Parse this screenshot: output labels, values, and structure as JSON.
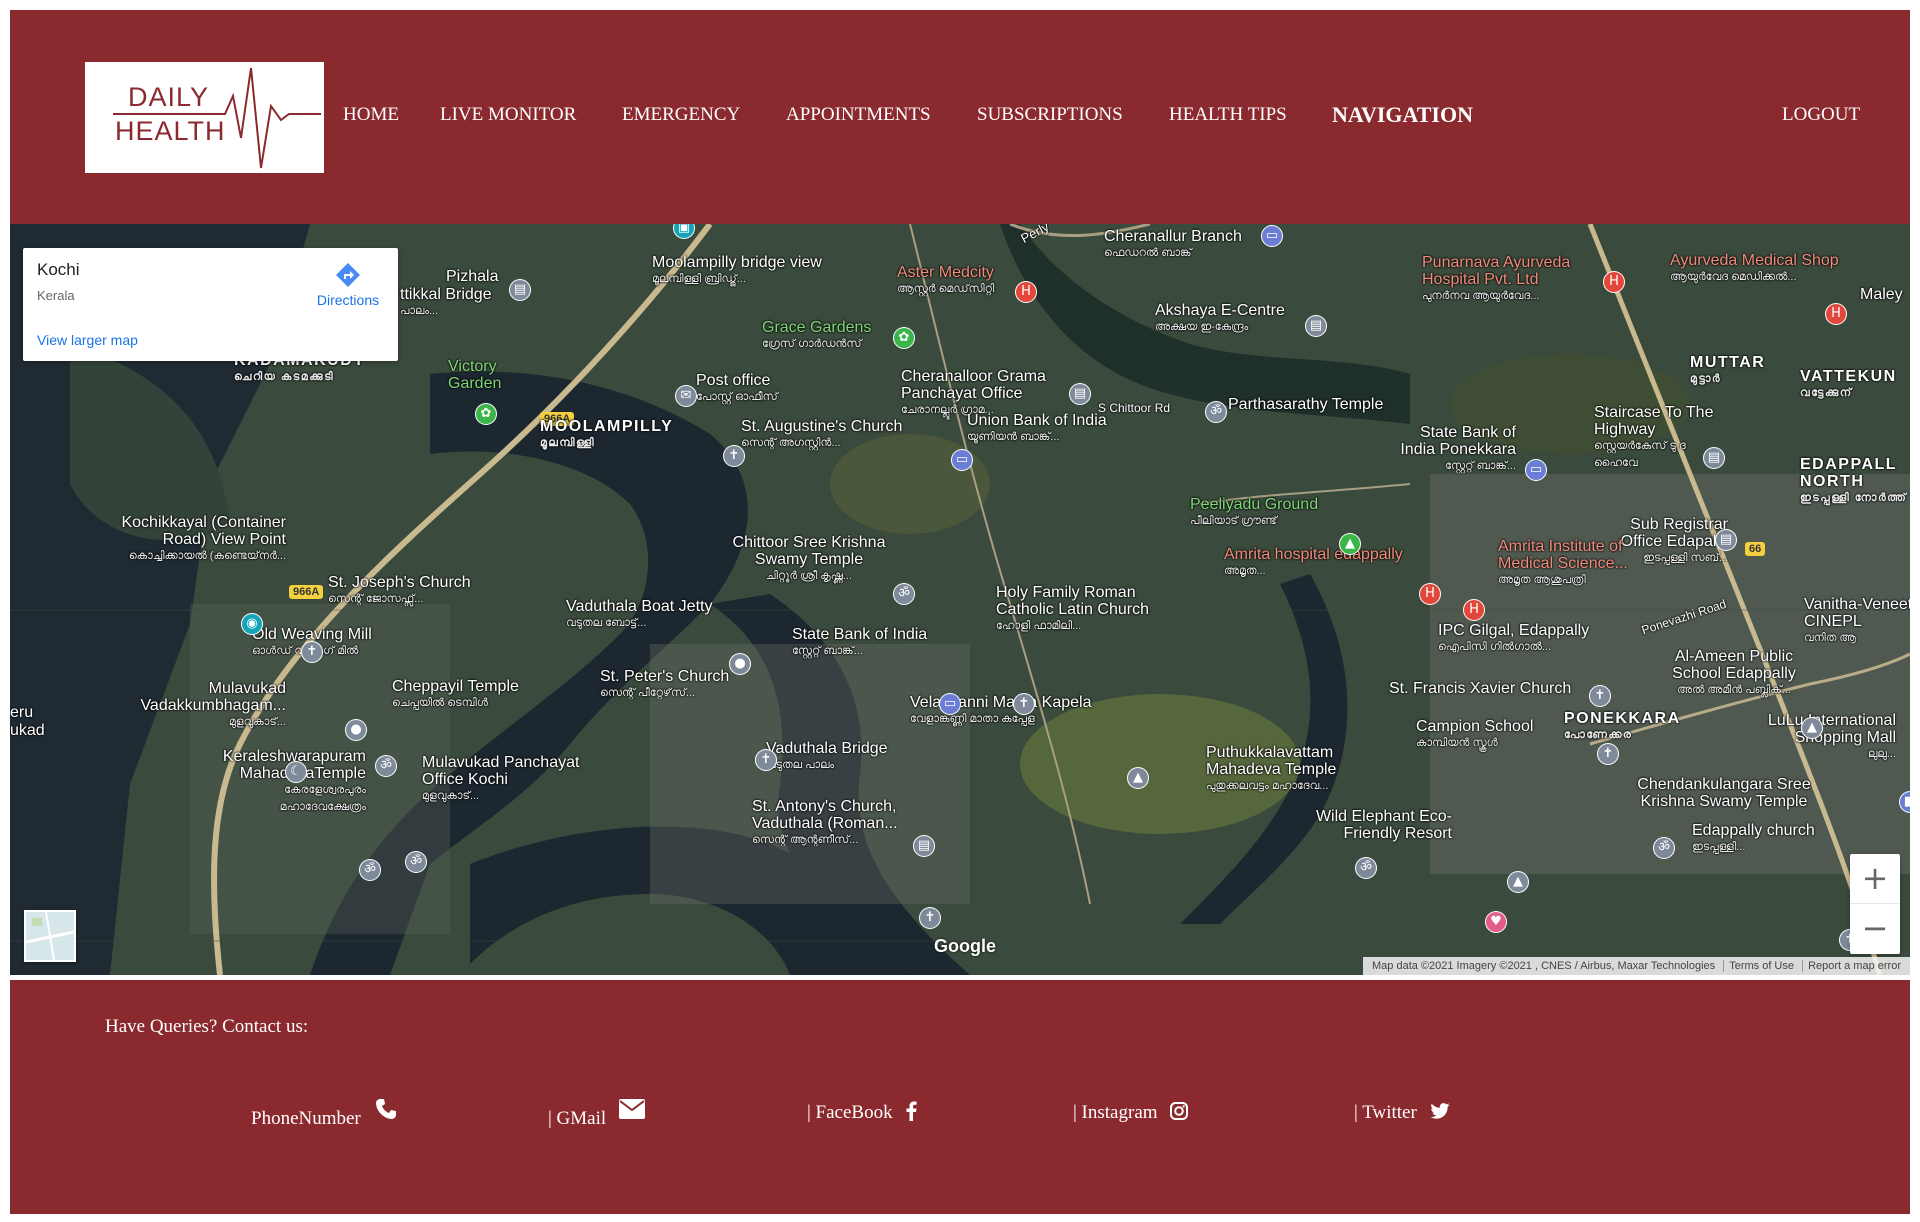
{
  "brand": {
    "line1": "DAILY",
    "line2": "HEALTH",
    "accent": "#8b2a2e"
  },
  "nav": {
    "items": [
      "HOME",
      "LIVE MONITOR",
      "EMERGENCY",
      "APPOINTMENTS",
      "SUBSCRIPTIONS",
      "HEALTH TIPS",
      "NAVIGATION"
    ],
    "active": "NAVIGATION",
    "logout": "LOGOUT"
  },
  "map": {
    "info": {
      "place": "Kochi",
      "region": "Kerala",
      "directions": "Directions",
      "larger": "View larger map"
    },
    "zoom_in": "+",
    "zoom_out": "−",
    "google": "Google",
    "attribution": [
      "Map data ©2021 Imagery ©2021 , CNES / Airbus, Maxar Technologies",
      "Terms of Use",
      "Report a map error"
    ],
    "labels": {
      "moolampilly_bridge": "Moolampilly bridge view",
      "moolampilly_bridge_ml": "മൂലമ്പിള്ളി ബ്രിഡ്ജ്...",
      "aster": "Aster Medcity",
      "aster_ml": "ആസ്റ്റർ മെഡ്‌സിറ്റി",
      "cheranallur_branch": "Cheranallur Branch",
      "cheranallur_branch_ml": "ഫെഡറൽ ബാങ്ക്",
      "punarnava": "Punarnava Ayurveda Hospital Pvt. Ltd",
      "punarnava_ml": "പുനർനവ ആയുർവേദ...",
      "ayurvedic_shop": "Ayurveda Medical Shop",
      "ayurvedic_shop_ml": "ആയുർവേദ മെഡിക്കൽ...",
      "maley": "Maley",
      "pizhala": "Pizhala",
      "kattikkal": "ttikkal Bridge",
      "kattikkal_ml": "പാലം...",
      "grace_gardens": "Grace Gardens",
      "grace_gardens_ml": "ഗ്രേസ് ഗാർഡൻസ്",
      "akshaya": "Akshaya E-Centre",
      "akshaya_ml": "അക്ഷയ ഇ-കേന്ദ്രം",
      "kadamakudy": "KADAMAKUDY",
      "kadamakudy_ml": "ചെറിയ കടമക്കുടി",
      "victory_garden": "Victory Garden",
      "post_office": "Post office",
      "post_office_ml": "പോസ്റ്റ് ഓഫീസ്",
      "cheranalloor_grama": "Cheranalloor Grama Panchayat Office",
      "cheranalloor_grama_ml": "ചേരാനല്ലൂർ ഗ്രാമ...",
      "parthasarathy": "Parthasarathy Temple",
      "muttar": "MUTTAR",
      "muttar_ml": "മുട്ടാർ",
      "vattekun": "VATTEKUN",
      "vattekun_ml": "വട്ടേക്കുന്",
      "moolampilly": "MOOLAMPILLY",
      "moolampilly_ml": "മൂലമ്പിള്ളി",
      "st_augustine": "St. Augustine's Church",
      "st_augustine_ml": "സെന്റ് അഗസ്റ്റിൻ...",
      "union_bank": "Union Bank of India",
      "union_bank_ml": "യൂണിയൻ ബാങ്ക്...",
      "s_chittoor": "S Chittoor Rd",
      "sbi_ponekkara": "State Bank of India Ponekkara",
      "sbi_ponekkara_ml": "സ്റ്റേറ്റ് ബാങ്ക്...",
      "staircase": "Staircase To The Highway",
      "staircase_ml": "സ്റ്റെയർകേസ് ടു ദ ഹൈവേ",
      "edappally_north": "EDAPPALL NORTH",
      "edappally_north_ml": "ഇടപ്പള്ളി നോർത്ത്",
      "kochikkayal": "Kochikkayal (Container Road) View Point",
      "kochikkayal_ml": "കൊച്ചിക്കായൽ (കണ്ടെയ്‌നർ...",
      "peeliyadu": "Peeliyadu Ground",
      "peeliyadu_ml": "പീലിയാട് ഗ്രൗണ്ട്",
      "sub_registrar": "Sub Registrar Office Edapally",
      "sub_registrar_ml": "ഇടപ്പള്ളി സബ്...",
      "chittoor_sree": "Chittoor Sree Krishna Swamy Temple",
      "chittoor_sree_ml": "ചിറ്റൂർ ശ്രീ കൃഷ്ണ...",
      "amrita_hosp": "Amrita hospital edappally",
      "amrita_hosp_ml": "അമൃത...",
      "amrita_inst": "Amrita Institute of Medical Science...",
      "amrita_inst_ml": "അമൃത ആശുപത്രി",
      "st_joseph": "St. Joseph's Church",
      "st_joseph_ml": "സെന്റ് ജോസഫ്സ്...",
      "holy_family": "Holy Family Roman Catholic Latin Church",
      "holy_family_ml": "ഹോളി ഫാമിലി...",
      "vanitha": "Vanitha-Veneet CINEPL",
      "vanitha_ml": "വനിത ആ",
      "vaduthala_jetty": "Vaduthala Boat Jetty",
      "vaduthala_jetty_ml": "വടുതല ബോട്ട്...",
      "old_weaving": "Old Weaving Mill",
      "old_weaving_ml": "ഓൾഡ് വീവിംഗ് മിൽ",
      "sbi": "State Bank of India",
      "sbi_ml": "സ്റ്റേറ്റ് ബാങ്ക്...",
      "ipc_gilgal": "IPC Gilgal, Edappally",
      "ipc_gilgal_ml": "ഐപിസി ഗിൽഗാൽ...",
      "ponevazhi": "Ponevazhi Road",
      "al_ameen": "Al-Ameen Public School Edappally",
      "al_ameen_ml": "അൽ അമീൻ പബ്ലിക്...",
      "mulavukad_vad": "Mulavukad Vadakkumbhagam...",
      "mulavukad_vad_ml": "മുളവുകാട്...",
      "cheppayil": "Cheppayil Temple",
      "cheppayil_ml": "ചെപ്പയിൽ ടെമ്പിൾ",
      "st_peter": "St. Peter's Church",
      "st_peter_ml": "സെന്റ് പീറ്റേഴ്‌സ്...",
      "st_francis": "St. Francis Xavier Church",
      "velankanni": "Velankanni Matha Kapela",
      "velankanni_ml": "വേളാങ്കണ്ണി മാതാ കപ്പേള",
      "ponekkara": "PONEKKARA",
      "ponekkara_ml": "പോണേക്കര",
      "lulu": "LuLu International Shopping Mall",
      "lulu_ml": "ലുലു...",
      "eru": "eru",
      "ukad": "ukad",
      "campion": "Campion School",
      "campion_ml": "കാമ്പിയൻ സ്കൂൾ",
      "vaduthala_bridge": "Vaduthala Bridge",
      "vaduthala_bridge_ml": "വടുതല പാലം",
      "keraleshwarapuram": "Keraleshwarapuram MahadevaTemple",
      "keraleshwarapuram_ml": "കേരളേശ്വരപുരം മഹാദേവക്ഷേത്രം",
      "mulavukad_panchayat": "Mulavukad Panchayat Office Kochi",
      "mulavukad_panchayat_ml": "മുളവുകാട്...",
      "puthukkalavattam": "Puthukkalavattam Mahadeva Temple",
      "puthukkalavattam_ml": "പുതുക്കലവട്ടം മഹാദേവ...",
      "chendankulangara": "Chendankulangara Sree Krishna Swamy Temple",
      "st_antony": "St. Antony's Church, Vaduthala (Roman...",
      "st_antony_ml": "സെന്റ് ആന്റണീസ്...",
      "wild_elephant": "Wild Elephant Eco-Friendly Resort",
      "edappally_church": "Edappally church",
      "edappally_church_ml": "ഇടപ്പള്ളി...",
      "perly": "Perly",
      "road_966a_1": "966A",
      "road_966a_2": "966A",
      "road_66": "66"
    }
  },
  "footer": {
    "title": "Have Queries? Contact us:",
    "phone": "PhoneNumber",
    "gmail": "| GMail",
    "facebook": "| FaceBook",
    "instagram": "| Instagram",
    "twitter": "| Twitter"
  }
}
